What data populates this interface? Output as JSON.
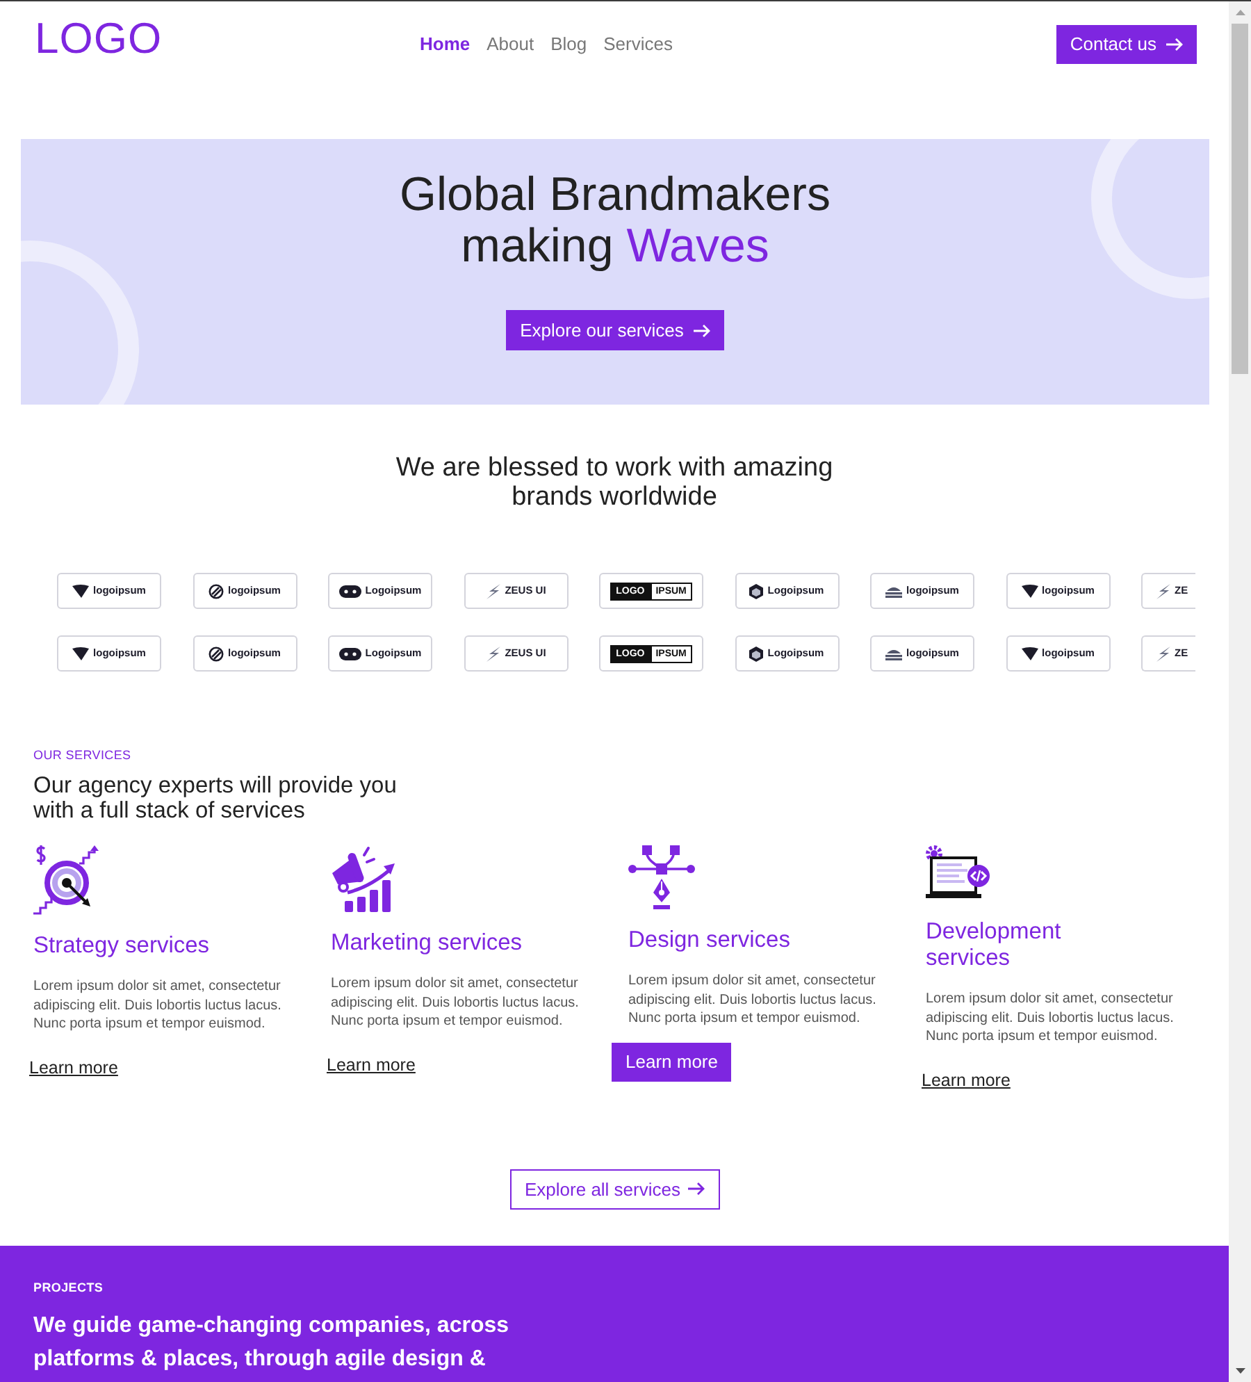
{
  "header": {
    "logo": "LOGO",
    "nav": [
      {
        "label": "Home",
        "selected": true
      },
      {
        "label": "About",
        "selected": false
      },
      {
        "label": "Blog",
        "selected": false
      },
      {
        "label": "Services",
        "selected": false
      }
    ],
    "cta": "Contact us"
  },
  "hero": {
    "title": "Global Brandmakers making",
    "title_accent": "Waves",
    "button": "Explore our services"
  },
  "clients": {
    "title": "We are blessed to work with amazing brands worldwide",
    "rows": [
      [
        {
          "kind": "icon",
          "text": "logoipsum"
        },
        {
          "kind": "icon",
          "text": "logoipsum"
        },
        {
          "kind": "icon",
          "text": "Logoipsum"
        },
        {
          "kind": "icon",
          "text": "ZEUS UI"
        },
        {
          "kind": "boxed",
          "text": "LOGO",
          "text_2": "IPSUM"
        },
        {
          "kind": "icon",
          "text": "Logoipsum"
        },
        {
          "kind": "icon",
          "text": "logoipsum"
        },
        {
          "kind": "icon",
          "text": "logoipsum"
        },
        {
          "kind": "icon",
          "text": "ZE"
        }
      ],
      [
        {
          "kind": "icon",
          "text": "logoipsum"
        },
        {
          "kind": "icon",
          "text": "logoipsum"
        },
        {
          "kind": "icon",
          "text": "Logoipsum"
        },
        {
          "kind": "icon",
          "text": "ZEUS UI"
        },
        {
          "kind": "boxed",
          "text": "LOGO",
          "text_2": "IPSUM"
        },
        {
          "kind": "icon",
          "text": "Logoipsum"
        },
        {
          "kind": "icon",
          "text": "logoipsum"
        },
        {
          "kind": "icon",
          "text": "logoipsum"
        },
        {
          "kind": "icon",
          "text": "ZE"
        }
      ]
    ]
  },
  "services": {
    "eyebrow": "OUR SERVICES",
    "title": "Our agency experts will provide you with a full stack of services",
    "items": [
      {
        "title": "Strategy services",
        "text": "Lorem ipsum dolor sit amet, consectetur adipiscing elit. Duis lobortis luctus lacus. Nunc porta ipsum et tempor euismod.",
        "cta": {
          "label": "Learn more",
          "kind": "link"
        }
      },
      {
        "title": "Marketing services",
        "text": "Lorem ipsum dolor sit amet, consectetur adipiscing elit. Duis lobortis luctus lacus. Nunc porta ipsum et tempor euismod.",
        "cta": {
          "label": "Learn more",
          "kind": "link"
        }
      },
      {
        "title": "Design services",
        "text": "Lorem ipsum dolor sit amet, consectetur adipiscing elit. Duis lobortis luctus lacus. Nunc porta ipsum et tempor euismod.",
        "cta": {
          "label": "Learn more",
          "kind": "button"
        }
      },
      {
        "title": "Development services",
        "text": "Lorem ipsum dolor sit amet, consectetur adipiscing elit. Duis lobortis luctus lacus. Nunc porta ipsum et tempor euismod.",
        "cta": {
          "label": "Learn more",
          "kind": "link"
        }
      }
    ],
    "more_button": "Explore all services"
  },
  "projects": {
    "eyebrow": "PROJECTS",
    "title": "We guide game-changing companies, across platforms & places, through agile design &"
  }
}
